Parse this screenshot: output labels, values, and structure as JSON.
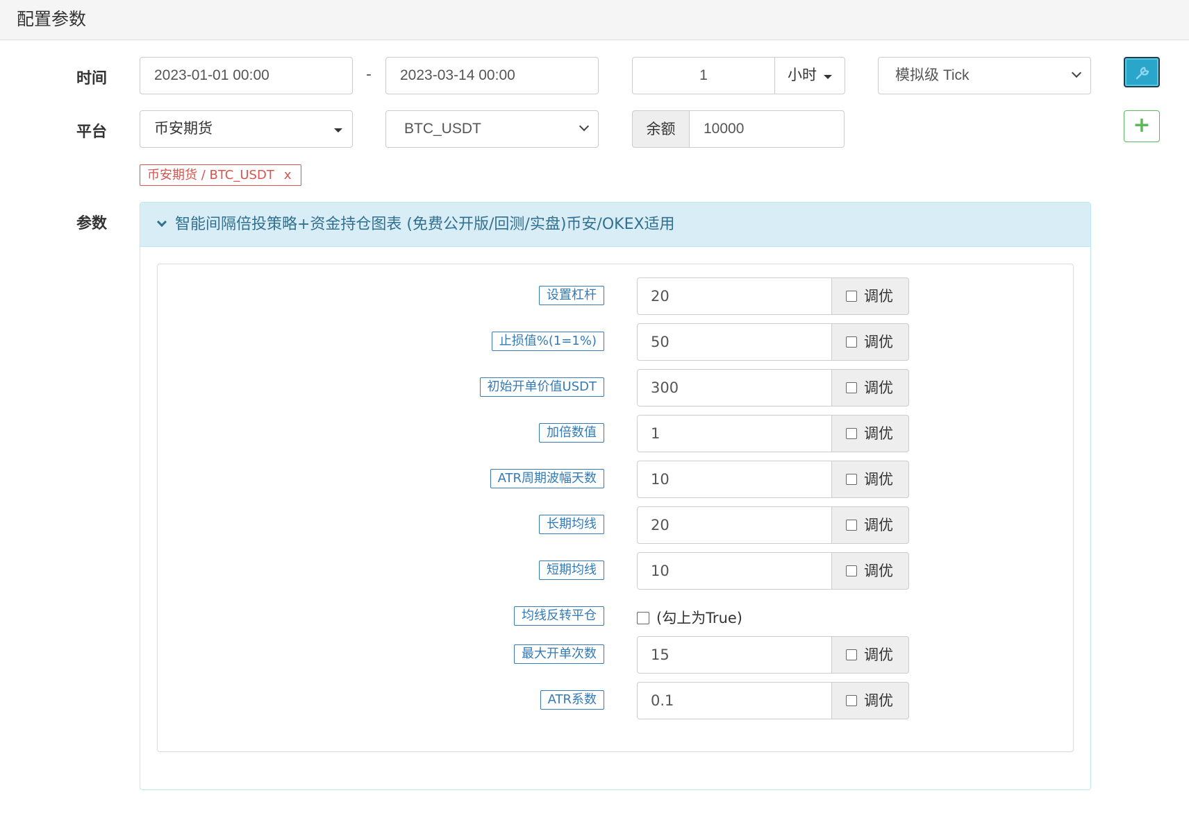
{
  "heading": "配置参数",
  "time_row": {
    "label": "时间",
    "start": "2023-01-01 00:00",
    "separator": "-",
    "end": "2023-03-14 00:00",
    "period_value": "1",
    "period_unit": "小时",
    "mode": "模拟级 Tick"
  },
  "platform_row": {
    "label": "平台",
    "exchange": "币安期货",
    "pair": "BTC_USDT",
    "balance_label": "余额",
    "balance": "10000"
  },
  "tag": {
    "text": "币安期货 / BTC_USDT",
    "remove": "x"
  },
  "params": {
    "label": "参数",
    "strategy_title": "智能间隔倍投策略+资金持仓图表 (免费公开版/回测/实盘)币安/OKEX适用",
    "optimize_label": "调优",
    "items": [
      {
        "name": "设置杠杆",
        "value": "20"
      },
      {
        "name": "止损值%(1=1%)",
        "value": "50"
      },
      {
        "name": "初始开单价值USDT",
        "value": "300"
      },
      {
        "name": "加倍数值",
        "value": "1"
      },
      {
        "name": "ATR周期波幅天数",
        "value": "10"
      },
      {
        "name": "长期均线",
        "value": "20"
      },
      {
        "name": "短期均线",
        "value": "10"
      }
    ],
    "bool_item": {
      "name": "均线反转平仓",
      "hint": "(勾上为True)"
    },
    "items2": [
      {
        "name": "最大开单次数",
        "value": "15"
      },
      {
        "name": "ATR系数",
        "value": "0.1"
      }
    ]
  },
  "colors": {
    "tag_red": "#d9534f",
    "label_blue": "#337ab7",
    "panel_head_bg": "#d9edf7",
    "wrench_button": "#2ba6cb",
    "add_button_green": "#5cb85c"
  },
  "icons": {
    "wrench": "wrench-icon",
    "add": "plus-icon"
  }
}
